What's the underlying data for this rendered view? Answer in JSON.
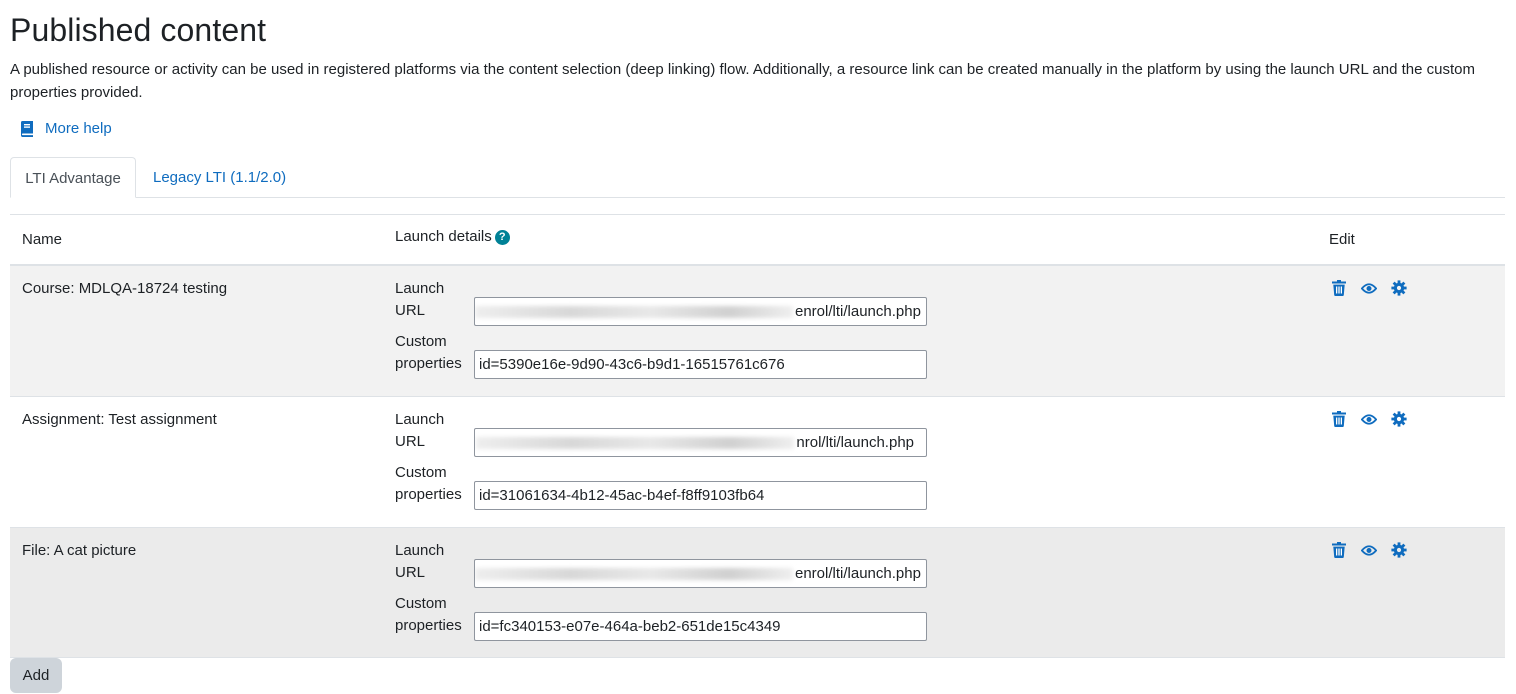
{
  "page": {
    "title": "Published content",
    "description": "A published resource or activity can be used in registered platforms via the content selection (deep linking) flow. Additionally, a resource link can be created manually in the platform by using the launch URL and the custom properties provided.",
    "help_label": "More help",
    "help_icon": "book-icon"
  },
  "tabs": [
    {
      "label": "LTI Advantage",
      "active": true
    },
    {
      "label": "Legacy LTI (1.1/2.0)",
      "active": false
    }
  ],
  "table": {
    "headers": {
      "name": "Name",
      "launch": "Launch details",
      "edit": "Edit"
    },
    "launch_help_icon": "question-icon",
    "launch_url_label_1": "Launch",
    "launch_url_label_2": "URL",
    "custom_label_1": "Custom",
    "custom_label_2": "properties",
    "rows": [
      {
        "name": "Course: MDLQA-18724 testing",
        "launch_url_suffix": "enrol/lti/launch.php",
        "custom": "id=5390e16e-9d90-43c6-b9d1-16515761c676"
      },
      {
        "name": "Assignment: Test assignment",
        "launch_url_suffix": "nrol/lti/launch.php",
        "custom": "id=31061634-4b12-45ac-b4ef-f8ff9103fb64"
      },
      {
        "name": "File: A cat picture",
        "launch_url_suffix": "enrol/lti/launch.php",
        "custom": "id=fc340153-e07e-464a-beb2-651de15c4349"
      }
    ],
    "action_icons": [
      "trash-icon",
      "eye-icon",
      "gear-icon"
    ]
  },
  "add_label": "Add",
  "colors": {
    "link": "#0f6cbf",
    "help_badge": "#008196",
    "row_stripe": "#f2f2f2",
    "button": "#ced4da"
  }
}
